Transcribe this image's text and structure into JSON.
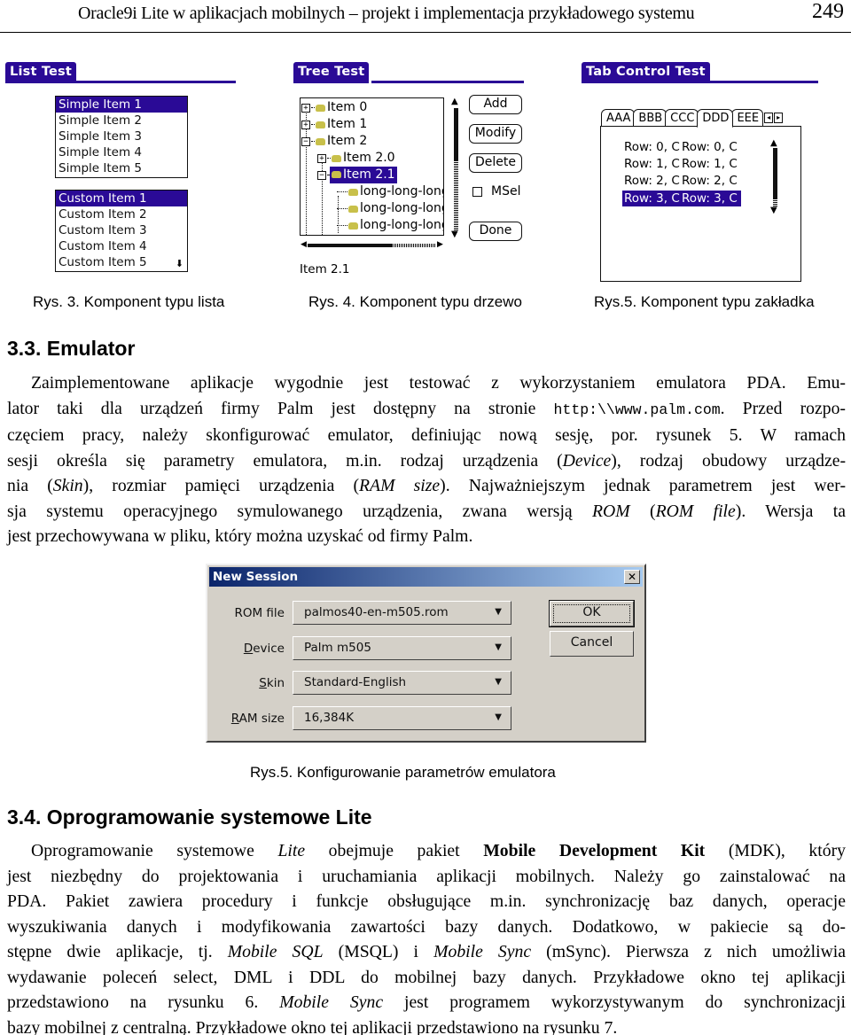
{
  "running_header": {
    "title": "Oracle9i Lite w aplikacjach mobilnych – projekt i implementacja przykładowego systemu",
    "page_number": "249"
  },
  "colors": {
    "palm_accent": "#2a0a96",
    "folder": "#c8c04a",
    "dialog_bg": "#d4d0c8",
    "dialog_title": "#0a246a"
  },
  "figures": {
    "list_test": {
      "title": "List Test",
      "simple_items": [
        "Simple Item 1",
        "Simple Item 2",
        "Simple Item 3",
        "Simple Item 4",
        "Simple Item 5"
      ],
      "simple_selected": 0,
      "custom_items": [
        "Custom Item 1",
        "Custom Item 2",
        "Custom Item 3",
        "Custom Item 4",
        "Custom Item 5"
      ],
      "custom_selected": 0,
      "scroll_icon": "down-arrow-icon",
      "caption": "Rys. 3. Komponent typu lista"
    },
    "tree_test": {
      "title": "Tree Test",
      "nodes": [
        {
          "label": "Item 0",
          "toggle": "+"
        },
        {
          "label": "Item 1",
          "toggle": "+"
        },
        {
          "label": "Item 2",
          "toggle": "−"
        },
        {
          "label": "Item 2.0",
          "toggle": "+"
        },
        {
          "label": "Item 2.1",
          "toggle": "−",
          "selected": true
        },
        {
          "label": "long-long-long",
          "toggle": ""
        },
        {
          "label": "long-long-long",
          "toggle": ""
        },
        {
          "label": "long-long-long",
          "toggle": ""
        }
      ],
      "buttons": {
        "add": "Add",
        "modify": "Modify",
        "delete": "Delete",
        "done": "Done"
      },
      "msel_label": "MSel",
      "msel_checked": false,
      "status": "Item 2.1",
      "caption": "Rys. 4. Komponent typu drzewo"
    },
    "tab_control_test": {
      "title": "Tab Control Test",
      "tabs": [
        "AAA",
        "BBB",
        "CCC",
        "DDD",
        "EEE"
      ],
      "active_tab": "DDD",
      "nav_prev": "◂",
      "nav_next": "▸",
      "rows": [
        [
          "Row: 0, C",
          "Row: 0, C"
        ],
        [
          "Row: 1, C",
          "Row: 1, C"
        ],
        [
          "Row: 2, C",
          "Row: 2, C"
        ],
        [
          "Row: 3, C",
          "Row: 3, C"
        ]
      ],
      "selected_row": 3,
      "caption": "Rys.5. Komponent typu zakładka"
    },
    "new_session_dialog": {
      "title": "New Session",
      "close_label": "✕",
      "fields": [
        {
          "label": "ROM file",
          "value": "palmos40-en-m505.rom"
        },
        {
          "label_prefix": "",
          "label_accel": "D",
          "label_rest": "evice",
          "value": "Palm m505"
        },
        {
          "label_prefix": "",
          "label_accel": "S",
          "label_rest": "kin",
          "value": "Standard-English"
        },
        {
          "label_prefix": "",
          "label_accel": "R",
          "label_rest": "AM size",
          "value": "16,384K"
        }
      ],
      "ok_label": "OK",
      "cancel_label": "Cancel",
      "caption": "Rys.5. Konfigurowanie parametrów emulatora"
    }
  },
  "sections": {
    "emulator": {
      "heading": "3.3.  Emulator",
      "lines": [
        "Zaimplementowane aplikacje wygodnie jest testować z wykorzystaniem emulatora PDA. Emu-",
        [
          "lator taki dla urządzeń firmy Palm jest dostępny na stronie ",
          "http:\\\\www.palm.com",
          ". Przed rozpo-"
        ],
        "częciem pracy, należy skonfigurować emulator, definiując nową sesję, por. rysunek 5. W ramach",
        [
          "sesji określa się parametry emulatora, m.in. rodzaj urządzenia (",
          "Device",
          "), rodzaj obudowy urządze-"
        ],
        [
          "nia (",
          "Skin",
          "), rozmiar pamięci urządzenia (",
          "RAM size",
          "). Najważniejszym jednak parametrem jest wer-"
        ],
        [
          "sja systemu operacyjnego symulowanego urządzenia, zwana wersją ",
          "ROM",
          " (",
          "ROM file",
          "). Wersja ta"
        ],
        "jest przechowywana w pliku, który można uzyskać od firmy Palm."
      ]
    },
    "lite": {
      "heading": "3.4.  Oprogramowanie systemowe Lite",
      "lines": [
        [
          "Oprogramowanie systemowe ",
          "Lite",
          " obejmuje pakiet ",
          "Mobile Development Kit",
          " (MDK), który"
        ],
        "jest niezbędny do projektowania i uruchamiania aplikacji mobilnych. Należy go zainstalować na",
        "PDA. Pakiet zawiera procedury i funkcje obsługujące m.in. synchronizację baz danych, operacje",
        "wyszukiwania danych i modyfikowania zawartości bazy danych. Dodatkowo, w pakiecie są do-",
        [
          "stępne dwie aplikacje, tj. ",
          "Mobile SQL",
          " (MSQL) i ",
          "Mobile Sync",
          " (mSync). Pierwsza z nich umożliwia"
        ],
        "wydawanie poleceń select, DML i DDL do mobilnej bazy danych. Przykładowe okno tej aplikacji",
        [
          "przedstawiono na rysunku 6. ",
          "Mobile Sync",
          " jest programem wykorzystywanym do synchronizacji"
        ],
        "bazy mobilnej z centralną. Przykładowe okno tej aplikacji przedstawiono na rysunku 7."
      ]
    }
  }
}
